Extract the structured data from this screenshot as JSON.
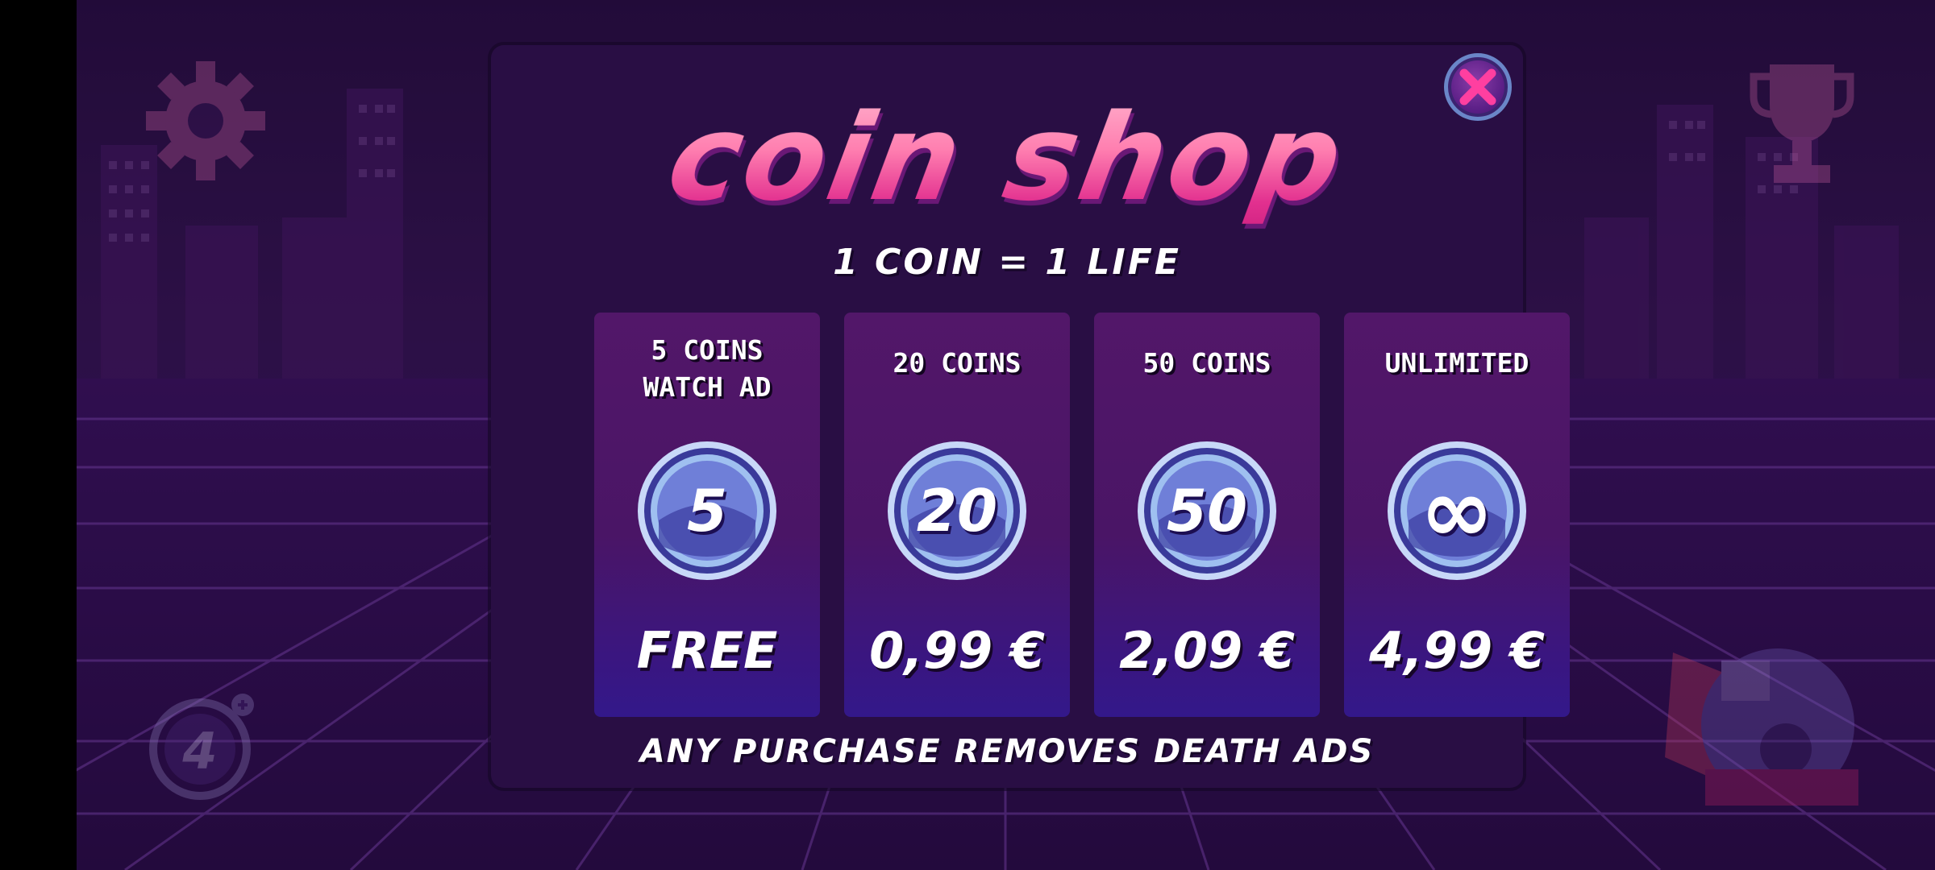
{
  "modal": {
    "title": "COIN SHOP",
    "subtitle": "1 COIN = 1 LIFE",
    "footer_note": "ANY PURCHASE REMOVES DEATH ADS",
    "close_icon": "close-x-icon"
  },
  "offers": [
    {
      "label_line1": "5 COINS",
      "label_line2": "WATCH AD",
      "coin_value": "5",
      "price": "FREE"
    },
    {
      "label_line1": "20 COINS",
      "coin_value": "20",
      "price": "0,99 €"
    },
    {
      "label_line1": "50 COINS",
      "coin_value": "50",
      "price": "2,09 €"
    },
    {
      "label_line1": "UNLIMITED",
      "coin_value": "∞",
      "price": "4,99 €"
    }
  ],
  "background": {
    "settings_icon": "gear-icon",
    "trophy_icon": "trophy-icon",
    "lives_icon": "lives-counter-icon",
    "lives_value": "4",
    "logo_icon": "game-logo-icon"
  },
  "colors": {
    "modal_bg": "#290e44",
    "title_gradient_top": "#ffc1d6",
    "title_gradient_bottom": "#c81c7b",
    "card_bg": "#4a1566",
    "coin_blue": "#6f7fd8",
    "grid_line": "#8a4cc0"
  }
}
